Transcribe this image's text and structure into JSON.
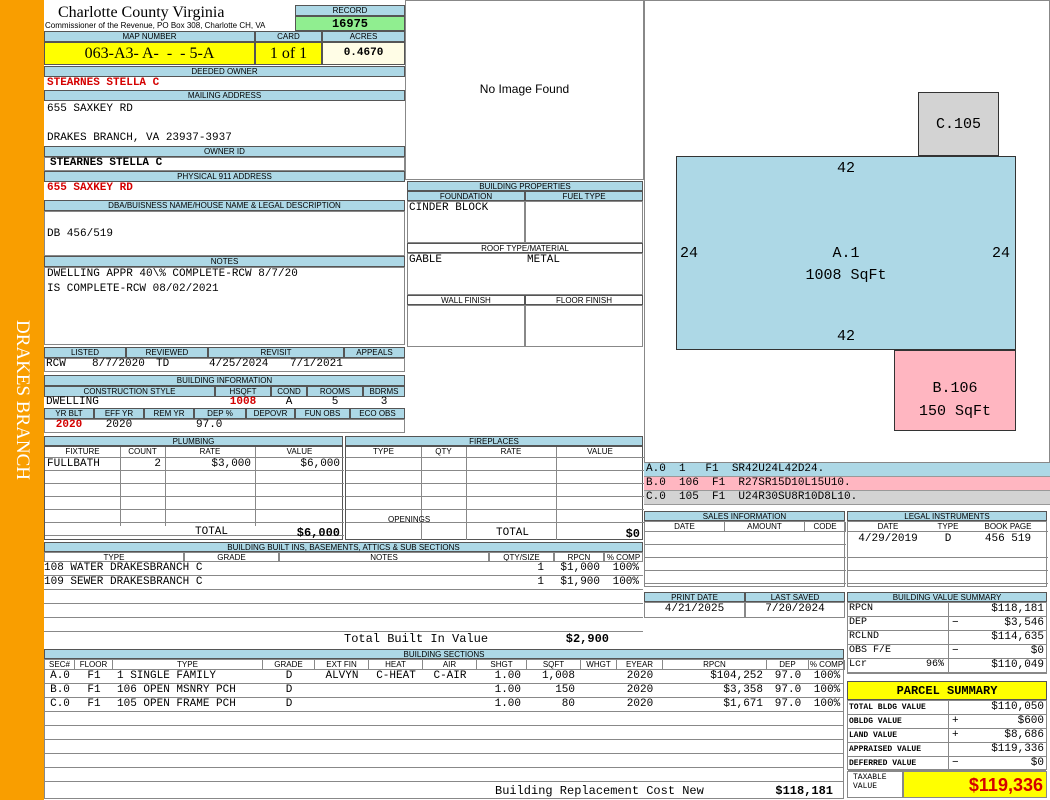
{
  "county": {
    "name": "Charlotte County Virginia",
    "sub": "Commissioner of the Revenue, PO Box 308, Charlotte CH, VA"
  },
  "sidebar_label": "DRAKES BRANCH",
  "record": {
    "label": "RECORD",
    "value": "16975"
  },
  "map": {
    "label": "MAP NUMBER",
    "value": "063-A3- A-  -  - 5-A"
  },
  "card": {
    "label": "CARD",
    "value": "1 of 1"
  },
  "acres": {
    "label": "ACRES",
    "value": "0.4670"
  },
  "deeded_owner": {
    "label": "DEEDED OWNER",
    "value": "STEARNES STELLA C"
  },
  "mailing": {
    "label": "MAILING ADDRESS",
    "line1": "655 SAXKEY RD",
    "line2": "DRAKES BRANCH, VA 23937-3937"
  },
  "owner_id": {
    "label": "OWNER ID",
    "value": "STEARNES STELLA C"
  },
  "physical": {
    "label": "PHYSICAL 911 ADDRESS",
    "value": "655 SAXKEY RD"
  },
  "dba": {
    "label": "DBA/BUISNESS NAME/HOUSE NAME & LEGAL DESCRIPTION",
    "value": "DB 456/519"
  },
  "notes": {
    "label": "NOTES",
    "line1": "DWELLING APPR 40\\% COMPLETE-RCW 8/7/20",
    "line2": "IS COMPLETE-RCW 08/02/2021"
  },
  "image": {
    "text": "No Image Found"
  },
  "dates": {
    "listed_label": "LISTED",
    "reviewed_label": "REVIEWED",
    "revisit_label": "REVISIT",
    "appeals_label": "APPEALS",
    "listed_by": "RCW",
    "listed": "8/7/2020",
    "reviewed_by": "TD",
    "reviewed": "4/25/2024",
    "revisit": "7/1/2021",
    "appeals": ""
  },
  "building_info": {
    "label": "BUILDING INFORMATION",
    "style_label": "CONSTRUCTION STYLE",
    "hsqft_label": "HSQFT",
    "cond_label": "COND",
    "rooms_label": "ROOMS",
    "bdrms_label": "BDRMS",
    "style": "DWELLING",
    "hsqft": "1008",
    "cond": "A",
    "rooms": "5",
    "bdrms": "3",
    "yrblt_label": "YR BLT",
    "effyr_label": "EFF YR",
    "remyr_label": "REM YR",
    "dep_label": "DEP %",
    "depovr_label": "DEPOVR",
    "funobs_label": "FUN OBS",
    "ecoobs_label": "ECO OBS",
    "yrblt": "2020",
    "effyr": "2020",
    "remyr": "",
    "dep": "97.0",
    "depovr": "",
    "funobs": "",
    "ecoobs": ""
  },
  "building_props": {
    "label": "BUILDING PROPERTIES",
    "foundation_label": "FOUNDATION",
    "fueltype_label": "FUEL TYPE",
    "foundation": "CINDER BLOCK",
    "fueltype": "",
    "roof_label": "ROOF TYPE/MATERIAL",
    "roof_type": "GABLE",
    "roof_material": "METAL",
    "wall_label": "WALL FINISH",
    "floor_label": "FLOOR FINISH"
  },
  "plumbing": {
    "label": "PLUMBING",
    "cols": [
      "FIXTURE",
      "COUNT",
      "RATE",
      "VALUE"
    ],
    "rows": [
      [
        "FULLBATH",
        "2",
        "$3,000",
        "$6,000"
      ]
    ],
    "total_label": "TOTAL",
    "total": "$6,000"
  },
  "fireplaces": {
    "label": "FIREPLACES",
    "cols": [
      "TYPE",
      "QTY",
      "RATE",
      "VALUE"
    ],
    "openings_label": "OPENINGS",
    "total_label": "TOTAL",
    "total": "$0"
  },
  "sketch": {
    "a_label": "A.1",
    "a_area": "1008 SqFt",
    "top": "42",
    "bottom": "42",
    "left": "24",
    "right": "24",
    "b_label": "B.106",
    "b_area": "150 SqFt",
    "c_label": "C.105"
  },
  "sketch_legend": [
    {
      "text": "A.0  1   F1  SR42U24L42D24.",
      "color": "#add8e6"
    },
    {
      "text": "B.0  106  F1  R27SR15D10L15U10.",
      "color": "#ffb6c1"
    },
    {
      "text": "C.0  105  F1  U24R30SU8R10D8L10.",
      "color": "#d3d3d3"
    }
  ],
  "sales": {
    "label": "SALES INFORMATION",
    "cols": [
      "DATE",
      "AMOUNT",
      "CODE"
    ]
  },
  "legal": {
    "label": "LEGAL INSTRUMENTS",
    "cols": [
      "DATE",
      "TYPE",
      "BOOK PAGE"
    ],
    "date": "4/29/2019",
    "type": "D",
    "bookpage": "456 519"
  },
  "builtins": {
    "label": "BUILDING BUILT INS, BASEMENTS, ATTICS & SUB SECTIONS",
    "cols": [
      "TYPE",
      "GRADE",
      "NOTES",
      "QTY/SIZE",
      "RPCN",
      "% COMP"
    ],
    "rows": [
      [
        "108 WATER DRAKESBRANCH C",
        "",
        "",
        "1",
        "$1,000",
        "100%"
      ],
      [
        "109 SEWER DRAKESBRANCH C",
        "",
        "",
        "1",
        "$1,900",
        "100%"
      ]
    ],
    "total_label": "Total Built In Value",
    "total": "$2,900"
  },
  "print": {
    "print_label": "PRINT DATE",
    "saved_label": "LAST SAVED",
    "print_date": "4/21/2025",
    "last_saved": "7/20/2024"
  },
  "value_summary": {
    "label": "BUILDING VALUE SUMMARY",
    "rows": [
      {
        "k": "RPCN",
        "sign": "",
        "v": "$118,181"
      },
      {
        "k": "DEP",
        "sign": "−",
        "v": "$3,546"
      },
      {
        "k": "RCLND",
        "sign": "",
        "v": "$114,635"
      },
      {
        "k": "OBS F/E",
        "sign": "−",
        "v": "$0"
      },
      {
        "k": "Lcr",
        "pct": "96%",
        "sign": "",
        "v": "$110,049"
      }
    ]
  },
  "parcel": {
    "title": "PARCEL SUMMARY",
    "rows": [
      {
        "k": "TOTAL BLDG VALUE",
        "sign": "",
        "v": "$110,050"
      },
      {
        "k": "OBLDG VALUE",
        "sign": "+",
        "v": "$600"
      },
      {
        "k": "LAND VALUE",
        "sign": "+",
        "v": "$8,686"
      },
      {
        "k": "APPRAISED VALUE",
        "sign": "",
        "v": "$119,336"
      },
      {
        "k": "DEFERRED VALUE",
        "sign": "−",
        "v": "$0"
      }
    ],
    "taxable_label": "TAXABLE VALUE",
    "taxable": "$119,336"
  },
  "sections": {
    "label": "BUILDING SECTIONS",
    "cols": [
      "SEC#",
      "FLOOR",
      "TYPE",
      "GRADE",
      "EXT FIN",
      "HEAT",
      "AIR",
      "SHGT",
      "SQFT",
      "WHGT",
      "EYEAR",
      "RPCN",
      "DEP",
      "% COMP"
    ],
    "rows": [
      [
        "A.0",
        "F1",
        "1 SINGLE FAMILY",
        "D",
        "ALVYN",
        "C-HEAT",
        "C-AIR",
        "1.00",
        "1,008",
        "",
        "2020",
        "$104,252",
        "97.0",
        "100%"
      ],
      [
        "B.0",
        "F1",
        "106 OPEN MSNRY PCH",
        "D",
        "",
        "",
        "",
        "1.00",
        "150",
        "",
        "2020",
        "$3,358",
        "97.0",
        "100%"
      ],
      [
        "C.0",
        "F1",
        "105 OPEN FRAME PCH",
        "D",
        "",
        "",
        "",
        "1.00",
        "80",
        "",
        "2020",
        "$1,671",
        "97.0",
        "100%"
      ]
    ],
    "total_label": "Building Replacement Cost New",
    "total": "$118,181"
  }
}
